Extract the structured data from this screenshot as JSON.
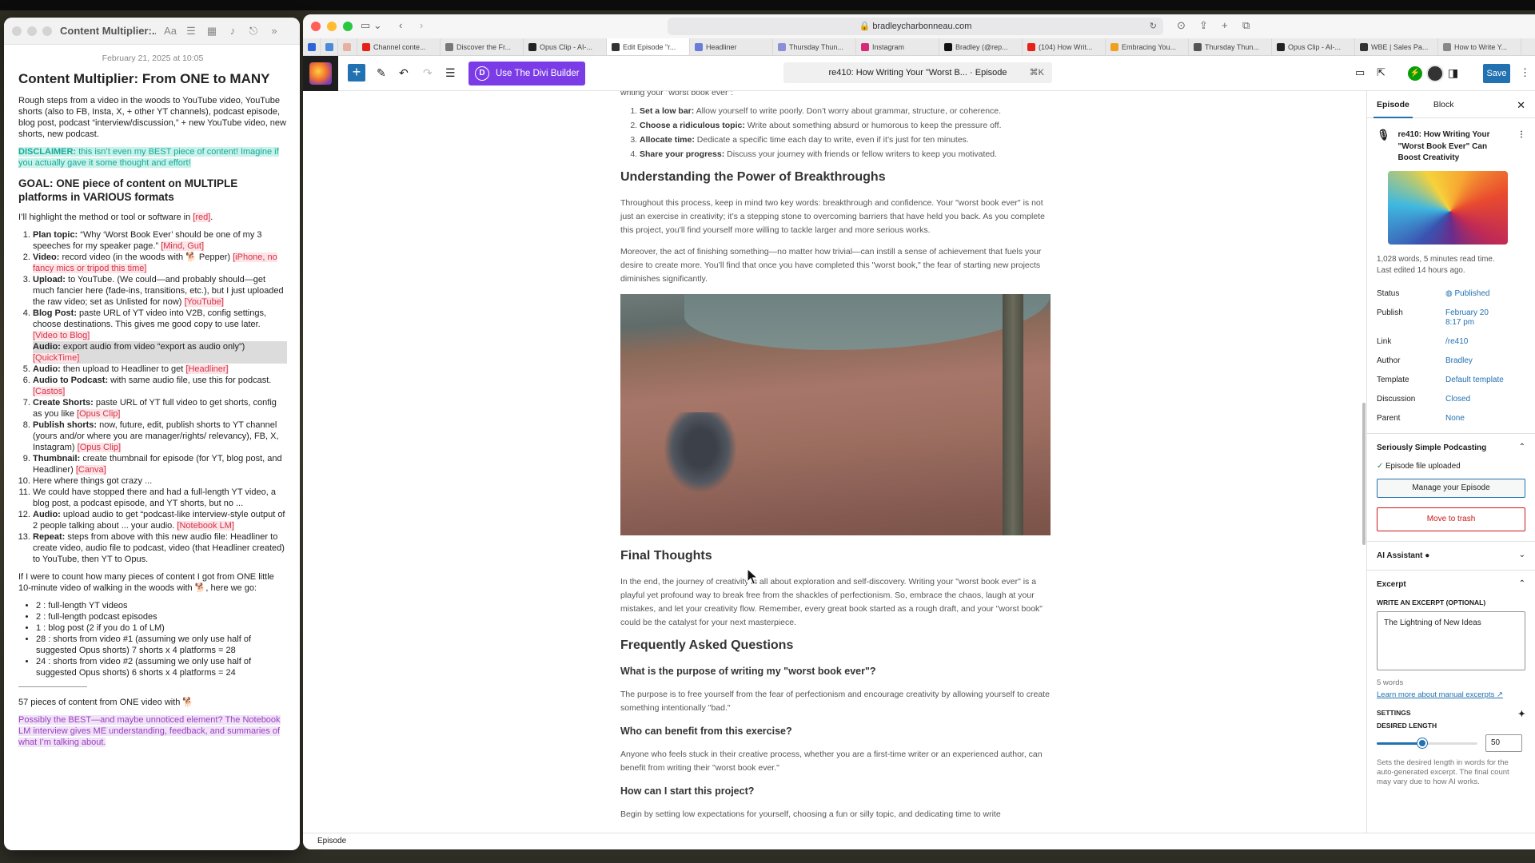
{
  "notes": {
    "window_title": "Content Multiplier:...",
    "date": "February 21, 2025 at 10:05",
    "title": "Content Multiplier: From ONE to MANY",
    "intro": "Rough steps from a video in the woods to YouTube video, YouTube shorts (also to FB, Insta, X, + other YT channels), podcast episode, blog post, podcast “interview/discussion,” + new YouTube video, new shorts, new podcast.",
    "disclaimer_label": "DISCLAIMER:",
    "disclaimer_text": " this isn’t even my BEST piece of content! Imagine if you actually gave it some thought and effort!",
    "goal": "GOAL: ONE piece of content on MULTIPLE platforms in VARIOUS formats",
    "highlight_pre": "I’ll highlight the method or tool or software in ",
    "highlight_tag": "[red]",
    "highlight_post": ".",
    "steps": [
      {
        "label": "Plan topic:",
        "text": " “Why ‘Worst Book Ever’ should be one of my 3 speeches for my speaker page.” ",
        "tool": "[Mind, Gut]"
      },
      {
        "label": "Video:",
        "text": " record video (in the woods with 🐕 Pepper) ",
        "tool": "[iPhone, no fancy mics or tripod this time]"
      },
      {
        "label": "Upload:",
        "text": " to YouTube. (We could—and probably should—get much fancier here (fade-ins, transitions, etc.), but I just uploaded the raw video; set as Unlisted for now) ",
        "tool": "[YouTube]"
      },
      {
        "label": "Blog Post:",
        "text": " paste URL of YT video into V2B, config settings, choose destinations. This gives me good copy to use later. ",
        "tool": "[Video to Blog]"
      },
      {
        "label": "Audio:",
        "text": " export audio from video “export as audio only”) ",
        "tool": "[QuickTime]"
      },
      {
        "label": "Audio:",
        "text": " then upload to Headliner to get ",
        "tool": "[Headliner]"
      },
      {
        "label": "Audio to Podcast:",
        "text": " with same audio file, use this for podcast. ",
        "tool": "[Castos]"
      },
      {
        "label": "Create Shorts:",
        "text": " paste URL of YT full video to get shorts, config as you like ",
        "tool": "[Opus Clip]"
      },
      {
        "label": "Publish shorts:",
        "text": " now, future, edit, publish shorts to YT channel (yours and/or where you are manager/rights/ relevancy), FB, X, Instagram) ",
        "tool": "[Opus Clip]"
      },
      {
        "label": "Thumbnail:",
        "text": " create thumbnail for episode (for YT, blog post, and Headliner) ",
        "tool": "[Canva]"
      },
      {
        "label": "",
        "text": "Here where things got crazy ...",
        "tool": ""
      },
      {
        "label": "",
        "text": "We could have stopped there and had a full-length YT video, a blog post, a podcast episode, and YT shorts, but no ...",
        "tool": ""
      },
      {
        "label": "Audio:",
        "text": " upload audio to get “podcast-like interview-style output of 2 people talking about ... your audio. ",
        "tool": "[Notebook LM]"
      },
      {
        "label": "Repeat:",
        "text": " steps from above with this new audio file: Headliner to create video, audio file to podcast, video (that Headliner created) to YouTube, then YT to Opus.",
        "tool": ""
      }
    ],
    "count_intro": "If I were to count how many pieces of content I got from ONE little 10-minute video of walking in the woods with 🐕, here we go:",
    "counts": [
      "2 : full-length YT videos",
      "2 :  full-length podcast episodes",
      "1 : blog post (2 if you do 1 of LM)",
      "28 : shorts from video #1 (assuming we only use half of suggested Opus shorts) 7 shorts x 4 platforms = 28",
      "24 : shorts from video #2 (assuming we only use half of suggested Opus shorts) 6 shorts x 4 platforms = 24"
    ],
    "total": "57 pieces of content from ONE video with 🐕",
    "closing": "Possibly the BEST—and maybe unnoticed element? The Notebook LM interview gives ME understanding, feedback, and summaries of what I’m talking about."
  },
  "browser": {
    "url": "bradleycharbonneau.com",
    "tabs": [
      {
        "label": "Channel conte...",
        "color": "#e62117"
      },
      {
        "label": "Discover the Fr...",
        "color": "#777777"
      },
      {
        "label": "Opus Clip - AI-...",
        "color": "#222222"
      },
      {
        "label": "Edit Episode \"r...",
        "color": "#333333"
      },
      {
        "label": "Headliner",
        "color": "#6a7bd8"
      },
      {
        "label": "Thursday Thun...",
        "color": "#8a8fd8"
      },
      {
        "label": "Instagram",
        "color": "#d62976"
      },
      {
        "label": "Bradley (@rep...",
        "color": "#111111"
      },
      {
        "label": "(104) How Writ...",
        "color": "#e62117"
      },
      {
        "label": "Embracing You...",
        "color": "#f0a020"
      },
      {
        "label": "Thursday Thun...",
        "color": "#555555"
      },
      {
        "label": "Opus Clip - AI-...",
        "color": "#222222"
      },
      {
        "label": "WBE | Sales Pa...",
        "color": "#333333"
      },
      {
        "label": "How to Write Y...",
        "color": "#888888"
      }
    ]
  },
  "editor": {
    "divi_label": "Use The Divi Builder",
    "doc_title": "re410: How Writing Your \"Worst B... · Episode",
    "shortcut": "⌘K",
    "save_label": "Save",
    "footer_label": "Episode"
  },
  "article": {
    "lead": "writing your \"worst book ever\":",
    "tips": [
      {
        "label": "Set a low bar:",
        "text": " Allow yourself to write poorly. Don’t worry about grammar, structure, or coherence."
      },
      {
        "label": "Choose a ridiculous topic:",
        "text": " Write about something absurd or humorous to keep the pressure off."
      },
      {
        "label": "Allocate time:",
        "text": " Dedicate a specific time each day to write, even if it’s just for ten minutes."
      },
      {
        "label": "Share your progress:",
        "text": " Discuss your journey with friends or fellow writers to keep you motivated."
      }
    ],
    "h_breakthroughs": "Understanding the Power of Breakthroughs",
    "p1": "Throughout this process, keep in mind two key words: breakthrough and confidence. Your \"worst book ever\" is not just an exercise in creativity; it’s a stepping stone to overcoming barriers that have held you back. As you complete this project, you’ll find yourself more willing to tackle larger and more serious works.",
    "p2": "Moreover, the act of finishing something—no matter how trivial—can instill a sense of achievement that fuels your desire to create more. You’ll find that once you have completed this \"worst book,\" the fear of starting new projects diminishes significantly.",
    "h_final": "Final Thoughts",
    "p3": "In the end, the journey of creativity is all about exploration and self-discovery. Writing your \"worst book ever\" is a playful yet profound way to break free from the shackles of perfectionism. So, embrace the chaos, laugh at your mistakes, and let your creativity flow. Remember, every great book started as a rough draft, and your \"worst book\" could be the catalyst for your next masterpiece.",
    "h_faq": "Frequently Asked Questions",
    "q1": "What is the purpose of writing my \"worst book ever\"?",
    "a1": "The purpose is to free yourself from the fear of perfectionism and encourage creativity by allowing yourself to create something intentionally \"bad.\"",
    "q2": "Who can benefit from this exercise?",
    "a2": "Anyone who feels stuck in their creative process, whether you are a first-time writer or an experienced author, can benefit from writing their \"worst book ever.\"",
    "q3": "How can I start this project?",
    "a3": "Begin by setting low expectations for yourself, choosing a fun or silly topic, and dedicating time to write"
  },
  "sidebar": {
    "tab_episode": "Episode",
    "tab_block": "Block",
    "ep_title": "re410: How Writing Your \"Worst Book Ever\" Can Boost Creativity",
    "meta_words": "1,028 words, 5 minutes read time.",
    "meta_edited": "Last edited 14 hours ago.",
    "rows": [
      {
        "label": "Status",
        "value": "Published"
      },
      {
        "label": "Publish",
        "value": "February 20 8:17 pm"
      },
      {
        "label": "Link",
        "value": "/re410"
      },
      {
        "label": "Author",
        "value": "Bradley"
      },
      {
        "label": "Template",
        "value": "Default template"
      },
      {
        "label": "Discussion",
        "value": "Closed"
      },
      {
        "label": "Parent",
        "value": "None"
      }
    ],
    "podcast_section": "Seriously Simple Podcasting",
    "file_status": "Episode file uploaded",
    "manage_btn": "Manage your Episode",
    "trash_btn": "Move to trash",
    "ai_section": "AI Assistant",
    "excerpt_section": "Excerpt",
    "excerpt_label": "WRITE AN EXCERPT (OPTIONAL)",
    "excerpt_text": "The Lightning of New Ideas",
    "excerpt_words": "5 words",
    "learn_link": "Learn more about manual excerpts ↗",
    "settings_label": "SETTINGS",
    "desired_label": "DESIRED LENGTH",
    "desired_value": "50",
    "desired_fraction": 0.45,
    "desired_help": "Sets the desired length in words for the auto-generated excerpt. The final count may vary due to how AI works."
  }
}
